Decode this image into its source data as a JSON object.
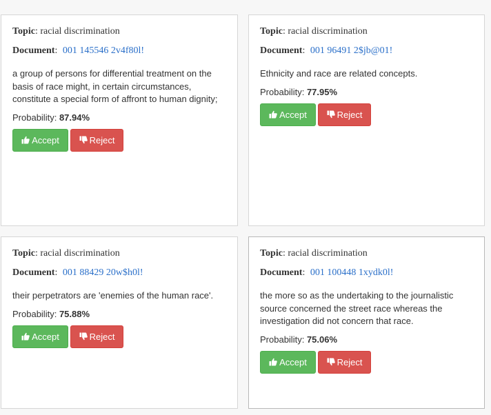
{
  "labels": {
    "topic": "Topic",
    "document": "Document",
    "probability": "Probability:",
    "accept": "Accept",
    "reject": "Reject"
  },
  "cards": [
    {
      "topic": "racial discrimination",
      "document_id": "001 145546 2v4f80l!",
      "text": "a group of persons for differential treatment on the basis of race might, in certain circumstances, constitute a special form of affront to human dignity;",
      "probability": "87.94%"
    },
    {
      "topic": "racial discrimination",
      "document_id": "001 96491 2$jb@01!",
      "text": "Ethnicity and race are related concepts.",
      "probability": "77.95%"
    },
    {
      "topic": "racial discrimination",
      "document_id": "001 88429 20w$h0l!",
      "text": "their perpetrators are 'enemies of the human race'.",
      "probability": "75.88%"
    },
    {
      "topic": "racial discrimination",
      "document_id": "001 100448 1xydk0l!",
      "text": "the more so as the undertaking to the journalistic source concerned the street race whereas the investigation did not concern that race.",
      "probability": "75.06%"
    }
  ],
  "colors": {
    "accept": "#5cb85c",
    "reject": "#d9534f",
    "link": "#2a6fc9"
  },
  "icons": {
    "accept": "thumbs-up-icon",
    "reject": "thumbs-down-icon"
  }
}
